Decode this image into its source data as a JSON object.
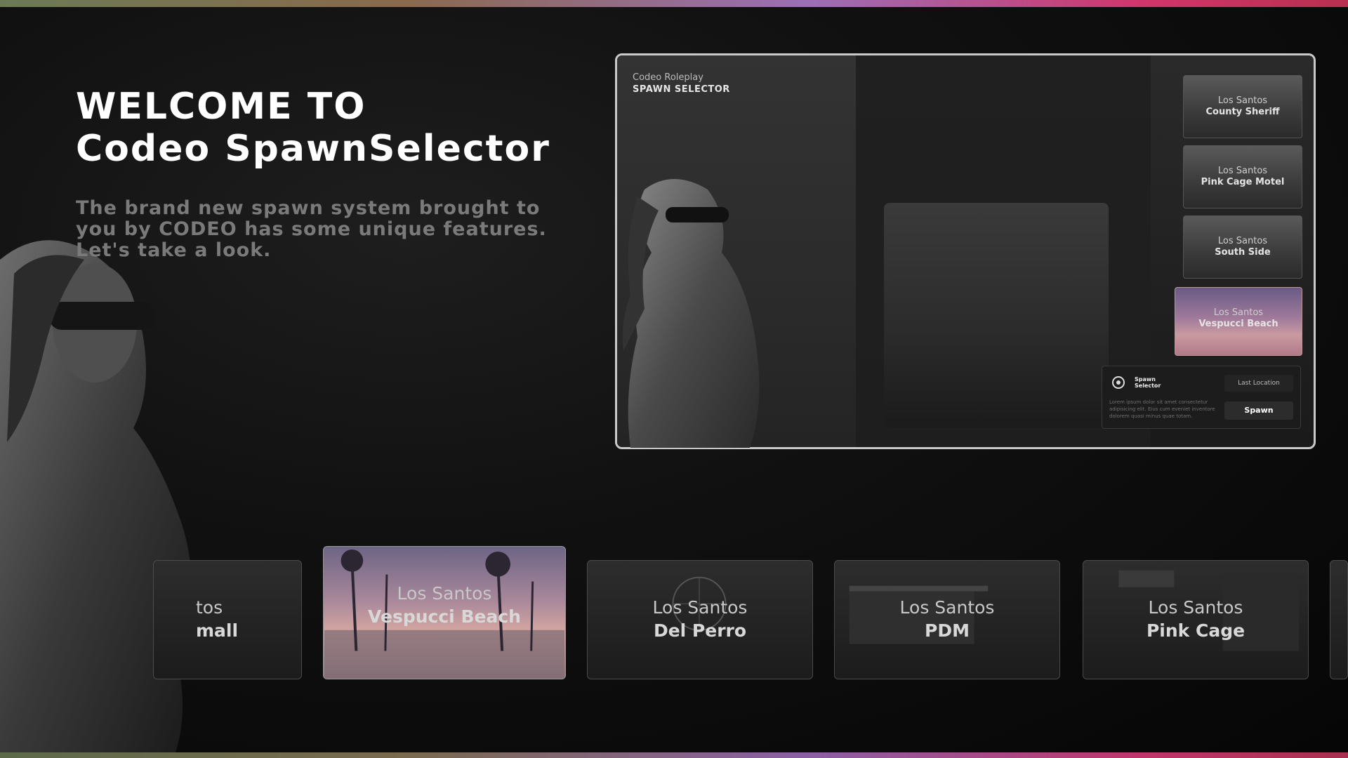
{
  "hero": {
    "title_line1": "WELCOME TO",
    "title_line2": "Codeo SpawnSelector",
    "description": "The brand new spawn system brought to you by CODEO has some unique features. Let's take a look."
  },
  "preview": {
    "brand_sub": "Codeo Roleplay",
    "brand_title": "SPAWN SELECTOR",
    "locations": [
      {
        "city": "Los Santos",
        "place": "County Sheriff"
      },
      {
        "city": "Los Santos",
        "place": "Pink Cage Motel"
      },
      {
        "city": "Los Santos",
        "place": "South Side"
      },
      {
        "city": "Los Santos",
        "place": "Vespucci Beach"
      }
    ],
    "spawn_panel": {
      "title": "Spawn Selector",
      "description": "Lorem ipsum dolor sit amet consectetur adipisicing elit. Eius cum eveniet inventore dolorem quasi minus quae totam.",
      "last_location_label": "Last Location",
      "spawn_label": "Spawn"
    }
  },
  "carousel": [
    {
      "city": "tos",
      "place": "mall"
    },
    {
      "city": "Los Santos",
      "place": "Vespucci Beach"
    },
    {
      "city": "Los Santos",
      "place": "Del Perro"
    },
    {
      "city": "Los Santos",
      "place": "PDM"
    },
    {
      "city": "Los Santos",
      "place": "Pink Cage"
    }
  ],
  "colors": {
    "accent_gradient_start": "#6b7a55",
    "accent_gradient_mid": "#9b6fb5",
    "accent_gradient_end": "#d1356b",
    "active_card_tint": "#c99aa0"
  }
}
